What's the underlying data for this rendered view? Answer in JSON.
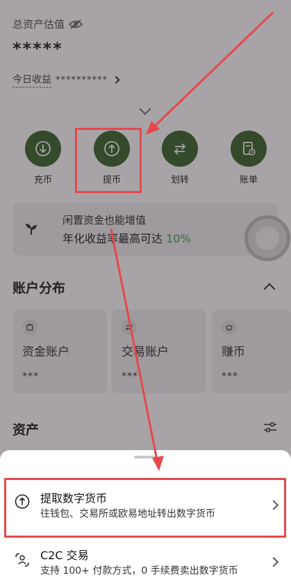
{
  "header": {
    "total_label": "总资产估值",
    "balance": "*****",
    "today_label": "今日收益",
    "today_value": "**********"
  },
  "actions": [
    {
      "label": "充币",
      "icon": "deposit-icon"
    },
    {
      "label": "提币",
      "icon": "withdraw-icon"
    },
    {
      "label": "划转",
      "icon": "transfer-icon"
    },
    {
      "label": "账单",
      "icon": "bill-icon"
    }
  ],
  "promo": {
    "title": "闲置资金也能增值",
    "subtitle": "年化收益率最高可达",
    "rate": "10%"
  },
  "accounts": {
    "title": "账户分布",
    "cards": [
      {
        "name": "资金账户",
        "value": "***",
        "icon": "wallet-icon"
      },
      {
        "name": "交易账户",
        "value": "***",
        "icon": "swap-icon"
      },
      {
        "name": "赚币",
        "value": "***",
        "icon": "piggy-icon"
      }
    ]
  },
  "assets": {
    "title": "资产"
  },
  "sheet": {
    "options": [
      {
        "title": "提取数字货币",
        "desc": "往钱包、交易所或欧易地址转出数字货币",
        "icon": "withdraw-icon"
      },
      {
        "title": "C2C 交易",
        "desc": "支持 100+ 付款方式，0 手续费卖出数字货币",
        "icon": "c2c-icon"
      }
    ]
  },
  "colors": {
    "accent_green": "#2e5d1f",
    "rate_green": "#2fa044",
    "highlight_red": "#e5484d"
  }
}
